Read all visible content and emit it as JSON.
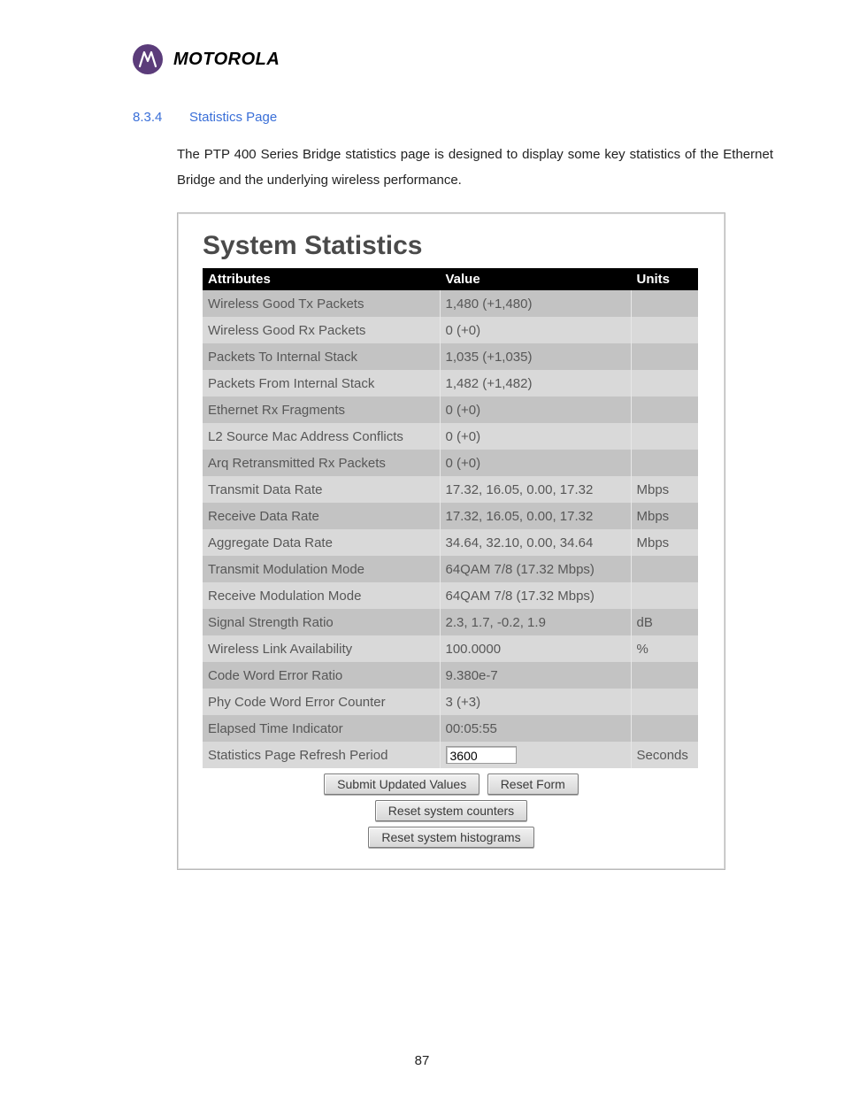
{
  "brand": {
    "name": "MOTOROLA"
  },
  "section": {
    "number": "8.3.4",
    "title": "Statistics Page"
  },
  "paragraph": "The PTP 400 Series Bridge statistics page is designed to display some key statistics of the Ethernet Bridge and the underlying wireless performance.",
  "screenshot_title": "System Statistics",
  "table": {
    "headers": {
      "attr": "Attributes",
      "value": "Value",
      "units": "Units"
    },
    "rows": [
      {
        "attr": "Wireless Good Tx Packets",
        "value": "1,480 (+1,480)",
        "units": ""
      },
      {
        "attr": "Wireless Good Rx Packets",
        "value": "0 (+0)",
        "units": ""
      },
      {
        "attr": "Packets To Internal Stack",
        "value": "1,035 (+1,035)",
        "units": ""
      },
      {
        "attr": "Packets From Internal Stack",
        "value": "1,482 (+1,482)",
        "units": ""
      },
      {
        "attr": "Ethernet Rx Fragments",
        "value": "0 (+0)",
        "units": ""
      },
      {
        "attr": "L2 Source Mac Address Conflicts",
        "value": "0 (+0)",
        "units": ""
      },
      {
        "attr": "Arq Retransmitted Rx Packets",
        "value": "0 (+0)",
        "units": ""
      },
      {
        "attr": "Transmit Data Rate",
        "value": "17.32, 16.05, 0.00, 17.32",
        "units": "Mbps"
      },
      {
        "attr": "Receive Data Rate",
        "value": "17.32, 16.05, 0.00, 17.32",
        "units": "Mbps"
      },
      {
        "attr": "Aggregate Data Rate",
        "value": "34.64, 32.10, 0.00, 34.64",
        "units": "Mbps"
      },
      {
        "attr": "Transmit Modulation Mode",
        "value": "64QAM 7/8 (17.32 Mbps)",
        "units": ""
      },
      {
        "attr": "Receive Modulation Mode",
        "value": "64QAM 7/8 (17.32 Mbps)",
        "units": ""
      },
      {
        "attr": "Signal Strength Ratio",
        "value": "  2.3,   1.7,  -0.2,    1.9",
        "units": "dB"
      },
      {
        "attr": "Wireless Link Availability",
        "value": "100.0000",
        "units": "%"
      },
      {
        "attr": "Code Word Error Ratio",
        "value": "9.380e-7",
        "units": ""
      },
      {
        "attr": "Phy Code Word Error Counter",
        "value": "3 (+3)",
        "units": ""
      },
      {
        "attr": "Elapsed Time Indicator",
        "value": "00:05:55",
        "units": ""
      }
    ],
    "input_row": {
      "attr": "Statistics Page Refresh Period",
      "value": "3600",
      "units": "Seconds"
    }
  },
  "buttons": {
    "submit": "Submit Updated Values",
    "reset_form": "Reset Form",
    "reset_counters": "Reset system counters",
    "reset_histograms": "Reset system histograms"
  },
  "page_number": "87"
}
